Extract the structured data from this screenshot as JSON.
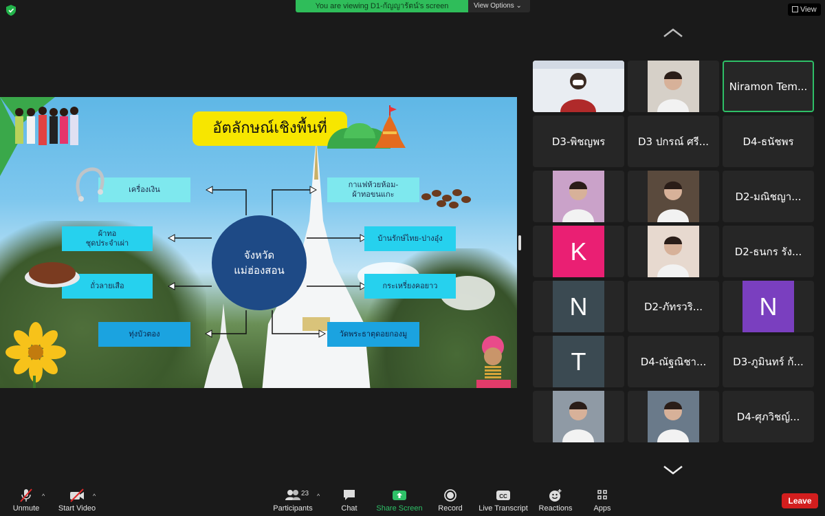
{
  "top": {
    "banner": "You are viewing D1-กัญญารัตน์'s screen",
    "view_options": "View Options",
    "view_button": "View"
  },
  "slide": {
    "title": "อัตลักษณ์เชิงพื้นที่",
    "center_line1": "จังหวัด",
    "center_line2": "แม่ฮ่องสอน",
    "items": [
      {
        "id": "silver",
        "text": "เครื่องเงิน"
      },
      {
        "id": "cloth",
        "text": "ผ้าทอ\nชุดประจำเผ่า"
      },
      {
        "id": "peanut",
        "text": "ถั่วลายเสือ"
      },
      {
        "id": "tung",
        "text": "ทุ่งบัวตอง"
      },
      {
        "id": "coffee",
        "text": "กาแฟห้วยห้อม-\nผ้าทอขนแกะ"
      },
      {
        "id": "village",
        "text": "บ้านรักษ์ไทย-ปางอุ๋ง"
      },
      {
        "id": "karen",
        "text": "กระเหรี่ยงคอยาว"
      },
      {
        "id": "temple",
        "text": "วัดพระธาตุดอยกองมู"
      }
    ]
  },
  "gallery": {
    "tiles": [
      {
        "name": "",
        "type": "video"
      },
      {
        "name": "",
        "type": "photo"
      },
      {
        "name": "Niramon Tem...",
        "type": "name",
        "active": true
      },
      {
        "name": "D3-พิชญพร",
        "type": "name"
      },
      {
        "name": "D3 ปกรณ์ ศรี...",
        "type": "name"
      },
      {
        "name": "D4-ธนัชพร",
        "type": "name"
      },
      {
        "name": "",
        "type": "photo"
      },
      {
        "name": "",
        "type": "photo"
      },
      {
        "name": "D2-มณิชญา...",
        "type": "name"
      },
      {
        "name": "K",
        "type": "letter",
        "color": "#ea1f73"
      },
      {
        "name": "",
        "type": "photo"
      },
      {
        "name": "D2-ธนกร รัง...",
        "type": "name"
      },
      {
        "name": "N",
        "type": "letter",
        "color": "#3b4a52"
      },
      {
        "name": "D2-ภัทรวริ...",
        "type": "name"
      },
      {
        "name": "N",
        "type": "letter",
        "color": "#7a3fbf"
      },
      {
        "name": "T",
        "type": "letter",
        "color": "#3b4a52"
      },
      {
        "name": "D4-ณัฐณิชา...",
        "type": "name"
      },
      {
        "name": "D3-ภูมินทร์ ก้...",
        "type": "name"
      },
      {
        "name": "",
        "type": "photo"
      },
      {
        "name": "",
        "type": "photo"
      },
      {
        "name": "D4-ศุภวิชญ์...",
        "type": "name"
      }
    ]
  },
  "toolbar": {
    "unmute": "Unmute",
    "start_video": "Start Video",
    "participants": "Participants",
    "participant_count": "23",
    "chat": "Chat",
    "share_screen": "Share Screen",
    "record": "Record",
    "live_transcript": "Live Transcript",
    "reactions": "Reactions",
    "apps": "Apps",
    "leave": "Leave"
  },
  "colors": {
    "accent_green": "#2ec067",
    "leave_red": "#d31e1e",
    "slide_title_bg": "#f7e600",
    "circle_blue": "#1e4a86"
  }
}
